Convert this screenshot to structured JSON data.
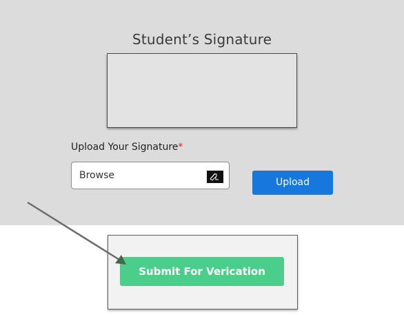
{
  "signature_section": {
    "title": "Student’s Signature"
  },
  "upload": {
    "label": "Upload Your Signature",
    "required_marker": "*",
    "browse_text": "Browse",
    "browse_icon": "file-icon",
    "button_label": "Upload"
  },
  "submit": {
    "button_label": "Submit For Verication"
  },
  "colors": {
    "panel_bg": "#dcdcdc",
    "upload_button": "#1877dc",
    "submit_button": "#4bce8b",
    "required": "#e02424"
  }
}
